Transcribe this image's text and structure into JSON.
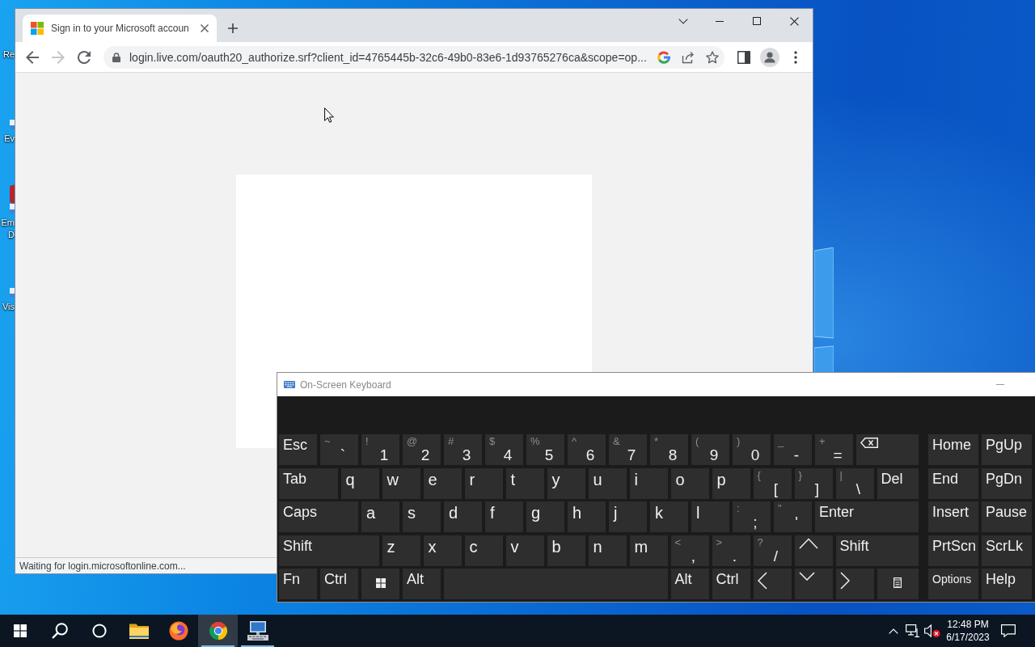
{
  "desktop": {
    "icons": [
      {
        "kind": "none",
        "label_lines": [
          "Re"
        ]
      },
      {
        "kind": "tile",
        "label_lines": [
          "Ev"
        ]
      },
      {
        "kind": "red-disc",
        "label_lines": [
          "Em",
          "D"
        ]
      },
      {
        "kind": "tile",
        "label_lines": [
          "Vis"
        ]
      }
    ]
  },
  "browser": {
    "tabs": [
      {
        "title": "Sign in to your Microsoft accoun",
        "selected": true
      }
    ],
    "nav_buttons": [
      {
        "kind": "back",
        "disabled": false
      },
      {
        "kind": "forward",
        "disabled": true
      },
      {
        "kind": "reload",
        "disabled": false
      }
    ],
    "address_bar": {
      "url": "login.live.com/oauth20_authorize.srf?client_id=4765445b-32c6-49b0-83e6-1d93765276ca&scope=op..."
    },
    "status_bar": "Waiting for login.microsoftonline.com..."
  },
  "keyboard": {
    "title": "On-Screen Keyboard",
    "rows": [
      {
        "keys": [
          {
            "kind": "label",
            "label": "Esc"
          },
          {
            "kind": "char",
            "shift": "~",
            "main": "`"
          },
          {
            "kind": "char",
            "shift": "!",
            "main": "1"
          },
          {
            "kind": "char",
            "shift": "@",
            "main": "2"
          },
          {
            "kind": "char",
            "shift": "#",
            "main": "3"
          },
          {
            "kind": "char",
            "shift": "$",
            "main": "4"
          },
          {
            "kind": "char",
            "shift": "%",
            "main": "5"
          },
          {
            "kind": "char",
            "shift": "^",
            "main": "6"
          },
          {
            "kind": "char",
            "shift": "&",
            "main": "7"
          },
          {
            "kind": "char",
            "shift": "*",
            "main": "8"
          },
          {
            "kind": "char",
            "shift": "(",
            "main": "9"
          },
          {
            "kind": "char",
            "shift": ")",
            "main": "0"
          },
          {
            "kind": "char",
            "shift": "_",
            "main": "-"
          },
          {
            "kind": "char",
            "shift": "+",
            "main": "="
          },
          {
            "kind": "backspace"
          }
        ]
      },
      {
        "keys": [
          {
            "kind": "label",
            "label": "Tab"
          },
          {
            "kind": "letter",
            "main": "q"
          },
          {
            "kind": "letter",
            "main": "w"
          },
          {
            "kind": "letter",
            "main": "e"
          },
          {
            "kind": "letter",
            "main": "r"
          },
          {
            "kind": "letter",
            "main": "t"
          },
          {
            "kind": "letter",
            "main": "y"
          },
          {
            "kind": "letter",
            "main": "u"
          },
          {
            "kind": "letter",
            "main": "i"
          },
          {
            "kind": "letter",
            "main": "o"
          },
          {
            "kind": "letter",
            "main": "p"
          },
          {
            "kind": "char",
            "shift": "{",
            "main": "["
          },
          {
            "kind": "char",
            "shift": "}",
            "main": "]"
          },
          {
            "kind": "char",
            "shift": "|",
            "main": "\\"
          },
          {
            "kind": "label",
            "label": "Del"
          }
        ]
      },
      {
        "keys": [
          {
            "kind": "label",
            "label": "Caps"
          },
          {
            "kind": "letter",
            "main": "a"
          },
          {
            "kind": "letter",
            "main": "s"
          },
          {
            "kind": "letter",
            "main": "d"
          },
          {
            "kind": "letter",
            "main": "f"
          },
          {
            "kind": "letter",
            "main": "g"
          },
          {
            "kind": "letter",
            "main": "h"
          },
          {
            "kind": "letter",
            "main": "j"
          },
          {
            "kind": "letter",
            "main": "k"
          },
          {
            "kind": "letter",
            "main": "l"
          },
          {
            "kind": "char",
            "shift": ":",
            "main": ";"
          },
          {
            "kind": "char",
            "shift": "\"",
            "main": "'"
          },
          {
            "kind": "label",
            "label": "Enter"
          }
        ]
      },
      {
        "keys": [
          {
            "kind": "label",
            "label": "Shift"
          },
          {
            "kind": "letter",
            "main": "z"
          },
          {
            "kind": "letter",
            "main": "x"
          },
          {
            "kind": "letter",
            "main": "c"
          },
          {
            "kind": "letter",
            "main": "v"
          },
          {
            "kind": "letter",
            "main": "b"
          },
          {
            "kind": "letter",
            "main": "n"
          },
          {
            "kind": "letter",
            "main": "m"
          },
          {
            "kind": "char",
            "shift": "<",
            "main": ","
          },
          {
            "kind": "char",
            "shift": ">",
            "main": "."
          },
          {
            "kind": "char",
            "shift": "?",
            "main": "/"
          },
          {
            "kind": "up"
          },
          {
            "kind": "label",
            "label": "Shift"
          }
        ]
      },
      {
        "keys": [
          {
            "kind": "label",
            "label": "Fn"
          },
          {
            "kind": "label",
            "label": "Ctrl"
          },
          {
            "kind": "windows"
          },
          {
            "kind": "label",
            "label": "Alt"
          },
          {
            "kind": "space"
          },
          {
            "kind": "label",
            "label": "Alt"
          },
          {
            "kind": "label",
            "label": "Ctrl"
          },
          {
            "kind": "left"
          },
          {
            "kind": "down"
          },
          {
            "kind": "right"
          },
          {
            "kind": "menu"
          }
        ]
      }
    ],
    "side_rows": [
      {
        "keys": [
          {
            "kind": "label",
            "label": "Home"
          },
          {
            "kind": "label",
            "label": "PgUp"
          }
        ]
      },
      {
        "keys": [
          {
            "kind": "label",
            "label": "End"
          },
          {
            "kind": "label",
            "label": "PgDn"
          }
        ]
      },
      {
        "keys": [
          {
            "kind": "label",
            "label": "Insert"
          },
          {
            "kind": "label",
            "label": "Pause"
          }
        ]
      },
      {
        "keys": [
          {
            "kind": "label",
            "label": "PrtScn"
          },
          {
            "kind": "label",
            "label": "ScrLk"
          }
        ]
      },
      {
        "keys": [
          {
            "kind": "small",
            "label": "Options"
          },
          {
            "kind": "label",
            "label": "Help"
          }
        ]
      }
    ]
  },
  "taskbar": {
    "apps": [
      {
        "kind": "start",
        "selected": false,
        "running": false
      },
      {
        "kind": "search",
        "selected": false,
        "running": false
      },
      {
        "kind": "assistant",
        "selected": false,
        "running": false
      },
      {
        "kind": "folder",
        "selected": false,
        "running": false
      },
      {
        "kind": "firefox",
        "selected": false,
        "running": false
      },
      {
        "kind": "chrome",
        "selected": true,
        "running": true
      },
      {
        "kind": "keyboard",
        "selected": false,
        "running": true
      }
    ],
    "tray": {
      "volume_muted": true
    },
    "clock": {
      "time": "12:48 PM",
      "date": "6/17/2023"
    }
  }
}
